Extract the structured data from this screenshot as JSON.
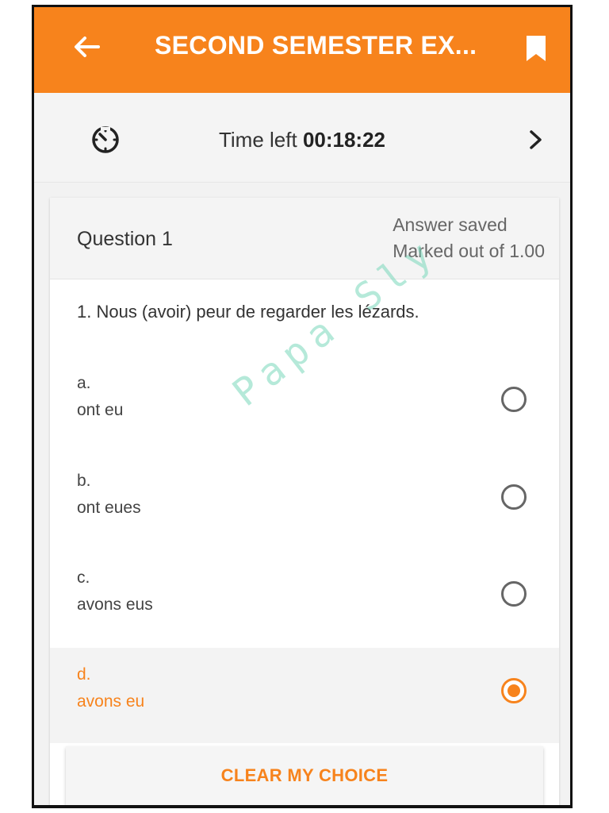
{
  "header": {
    "title": "SECOND SEMESTER EX...",
    "back_icon": "arrow-left-icon",
    "bookmark_icon": "bookmark-icon",
    "color": "#f7831c"
  },
  "timer": {
    "label": "Time left",
    "value": "00:18:22",
    "icon": "timer-icon",
    "next_icon": "chevron-right-icon"
  },
  "question": {
    "title": "Question 1",
    "status_line1": "Answer saved",
    "status_line2": "Marked out of 1.00",
    "text": "1. Nous (avoir) peur de regarder les lézards.",
    "options": [
      {
        "letter": "a.",
        "text": "ont eu",
        "selected": false
      },
      {
        "letter": "b.",
        "text": "ont eues",
        "selected": false
      },
      {
        "letter": "c.",
        "text": "avons eus",
        "selected": false
      },
      {
        "letter": "d.",
        "text": "avons eu",
        "selected": true
      }
    ],
    "clear_label": "CLEAR MY CHOICE"
  },
  "watermark": "Papa Sly"
}
